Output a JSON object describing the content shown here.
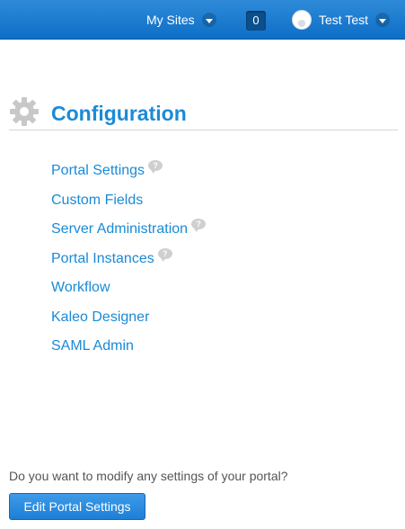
{
  "topbar": {
    "my_sites_label": "My Sites",
    "notification_count": "0",
    "user_name": "Test Test",
    "background_color": "#1a7bd0"
  },
  "header": {
    "title": "Configuration",
    "icon": "gear-icon"
  },
  "links": [
    {
      "label": "Portal Settings",
      "has_help": true
    },
    {
      "label": "Custom Fields",
      "has_help": false
    },
    {
      "label": "Server Administration",
      "has_help": true
    },
    {
      "label": "Portal Instances",
      "has_help": true
    },
    {
      "label": "Workflow",
      "has_help": false
    },
    {
      "label": "Kaleo Designer",
      "has_help": false
    },
    {
      "label": "SAML Admin",
      "has_help": false
    }
  ],
  "help_icon_glyph": "?",
  "footer": {
    "question": "Do you want to modify any settings of your portal?",
    "button_label": "Edit Portal Settings"
  },
  "colors": {
    "link": "#1a8ad6",
    "title": "#1c8ad6",
    "button": "#2a8ce0"
  }
}
